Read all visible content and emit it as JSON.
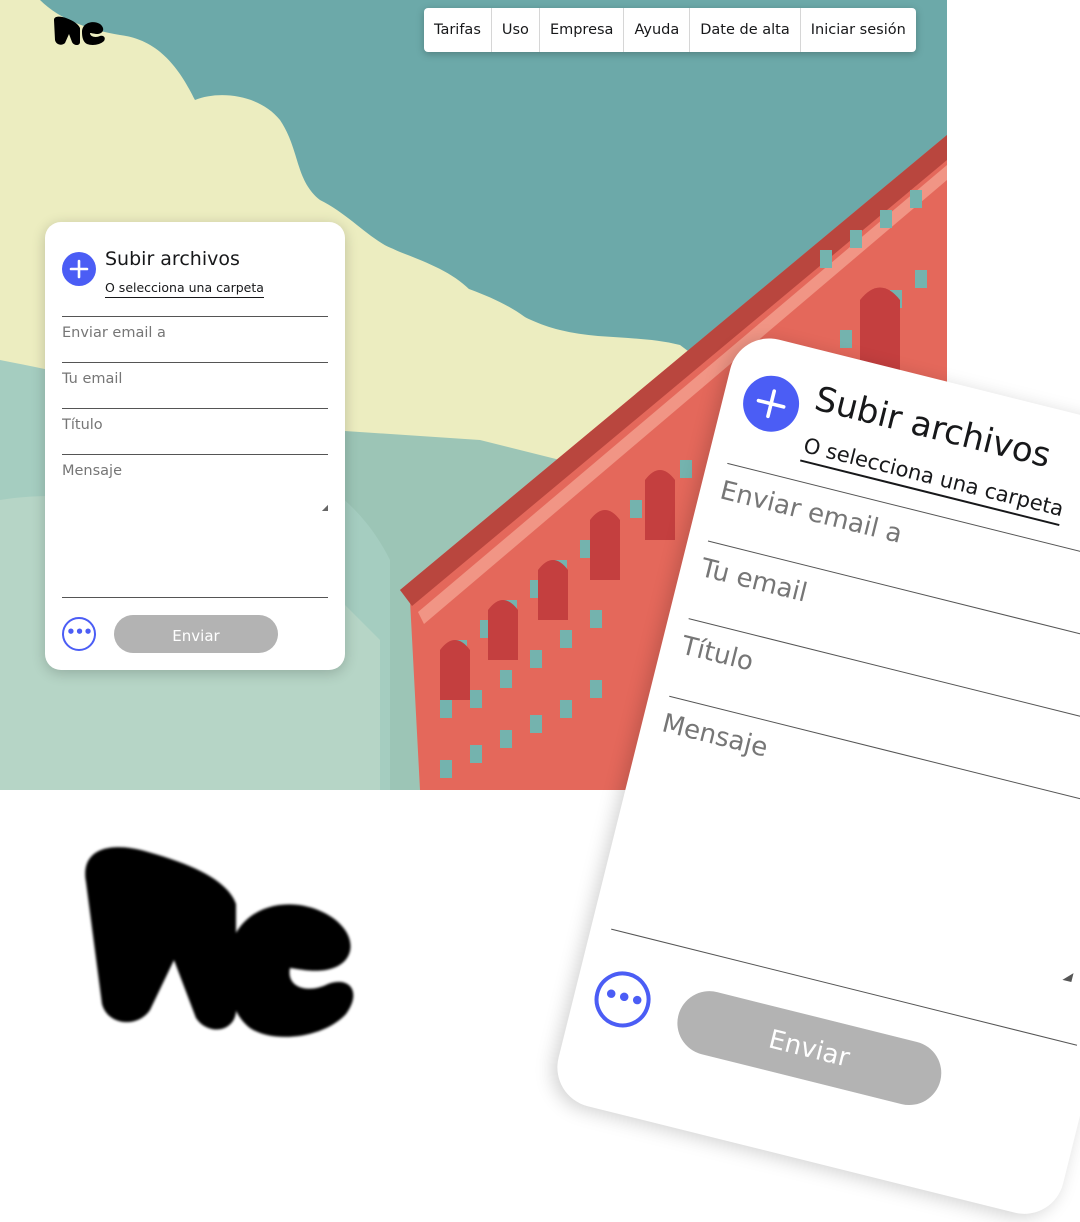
{
  "nav": {
    "items": [
      "Tarifas",
      "Uso",
      "Empresa",
      "Ayuda",
      "Date de alta",
      "Iniciar sesión"
    ]
  },
  "logo": {
    "icon": "wetransfer-logo-icon"
  },
  "upload_card": {
    "title": "Subir archivos",
    "folder_link": "O selecciona una carpeta",
    "fields": {
      "email_to": {
        "placeholder": "Enviar email a"
      },
      "your_email": {
        "placeholder": "Tu email"
      },
      "title": {
        "placeholder": "Título"
      },
      "message": {
        "placeholder": "Mensaje"
      }
    },
    "more_icon": "ellipsis-icon",
    "add_icon": "plus-icon",
    "send_label": "Enviar"
  },
  "colors": {
    "accent": "#4b5df5",
    "sky": "#6ba9a9",
    "cloud": "#ecedc0",
    "building": "#e2675b",
    "button_disabled": "#b3b3b3"
  }
}
